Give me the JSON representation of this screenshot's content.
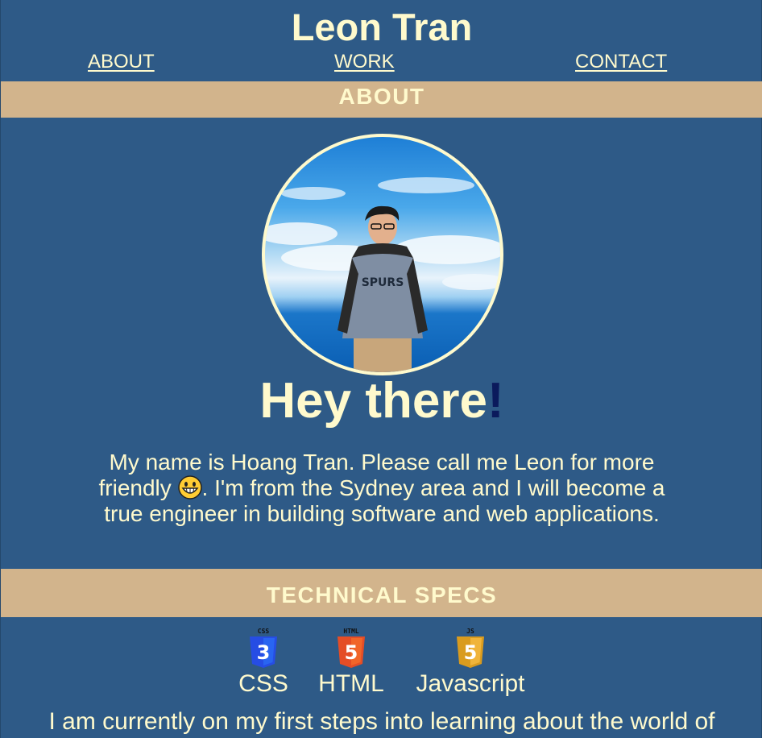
{
  "header": {
    "title": "Leon Tran",
    "nav": [
      {
        "label": "ABOUT"
      },
      {
        "label": "WORK"
      },
      {
        "label": "CONTACT"
      }
    ]
  },
  "about": {
    "section_title": "ABOUT",
    "greeting": "Hey there",
    "greeting_punct": "!",
    "intro_part1": "My name is Hoang Tran. Please call me Leon for more friendly ",
    "intro_part2": ". I'm from the Sydney area and I will become a true engineer in building software and web applications."
  },
  "technical": {
    "section_title": "TECHNICAL SPECS",
    "skills": [
      {
        "name": "CSS",
        "badge": "CSS",
        "icon": "css3-icon",
        "color": "#2965f1"
      },
      {
        "name": "HTML",
        "badge": "HTML",
        "icon": "html5-icon",
        "color": "#e44d26"
      },
      {
        "name": "Javascript",
        "badge": "JS",
        "icon": "js-icon",
        "color": "#e8a72b"
      }
    ],
    "outro": "I am currently on my first steps into learning about the world of"
  },
  "colors": {
    "background": "#2e5a87",
    "bar": "#d2b48c",
    "text": "#fffacd"
  }
}
